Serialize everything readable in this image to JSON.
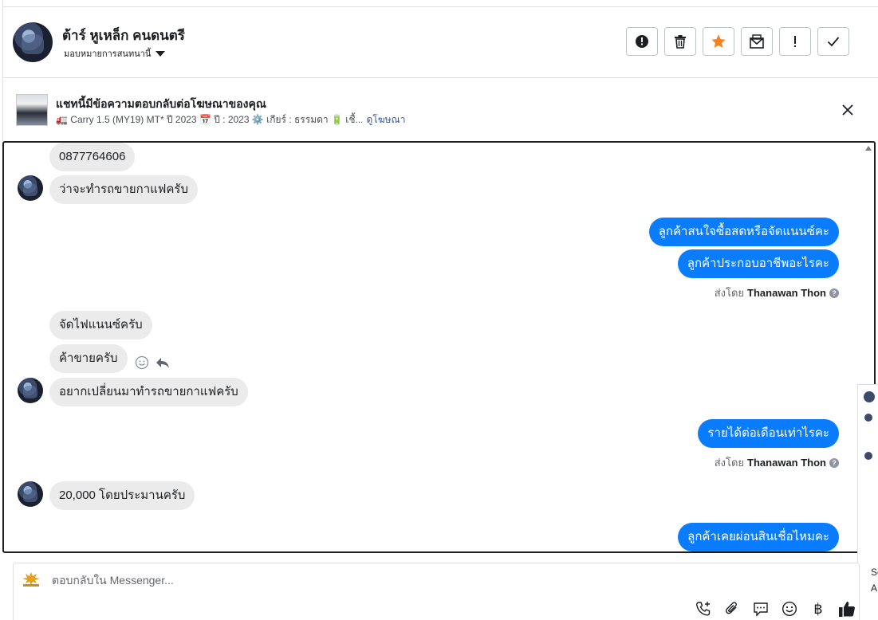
{
  "header": {
    "name": "ต้าร์ หูเหล็ก คนดนตรี",
    "assign_label": "มอบหมายการสนทนานี้",
    "toolbar": [
      {
        "id": "report",
        "icon": "alert-circle-icon"
      },
      {
        "id": "delete",
        "icon": "trash-icon"
      },
      {
        "id": "star",
        "icon": "star-icon",
        "color": "#f5821f"
      },
      {
        "id": "mark-unread",
        "icon": "envelope-icon"
      },
      {
        "id": "important",
        "icon": "exclamation-icon"
      },
      {
        "id": "done",
        "icon": "check-icon"
      }
    ]
  },
  "ad": {
    "title": "แชทนี้มีข้อความตอบกลับต่อโฆษณาของคุณ",
    "subtitle": "🚛 Carry 1.5 (MY19) MT* ปี 2023 📅 ปี : 2023 ⚙️ เกียร์ : ธรรมดา 🔋 เชื้...",
    "link": "ดูโฆษณา"
  },
  "messages": {
    "m1": "0877764606",
    "m2": "ว่าจะทำรถขายกาแฟครับ",
    "m3": "ลูกค้าสนใจซื้อสดหรือจัดแนนซ์คะ",
    "m4": "ลูกค้าประกอบอาชีพอะไรคะ",
    "m5": "จัดไฟแนนซ์ครับ",
    "m6": "ค้าขายครับ",
    "m7": "อยากเปลี่ยนมาทำรถขายกาแฟครับ",
    "m8": "รายได้ต่อเดือนเท่าไรคะ",
    "m9": "20,000 โดยประมานครับ",
    "m10": "ลูกค้าเคยผ่อนสินเชื่อไหมคะ"
  },
  "sent_by": {
    "prefix": "ส่งโดย",
    "agent": "Thanawan Thon",
    "help": "?"
  },
  "side_panel": {
    "text1": "Se",
    "text2": "A"
  },
  "composer": {
    "placeholder": "ตอบกลับใน Messenger...",
    "tools": [
      "phone-plus-icon",
      "paperclip-icon",
      "chat-bubble-icon",
      "smiley-icon",
      "baht-icon",
      "thumbs-up-icon"
    ],
    "baht_symbol": "฿"
  },
  "colors": {
    "outgoing_bubble": "#0a7cff",
    "incoming_bubble": "#ebebeb",
    "link": "#365899",
    "star": "#f5821f"
  }
}
